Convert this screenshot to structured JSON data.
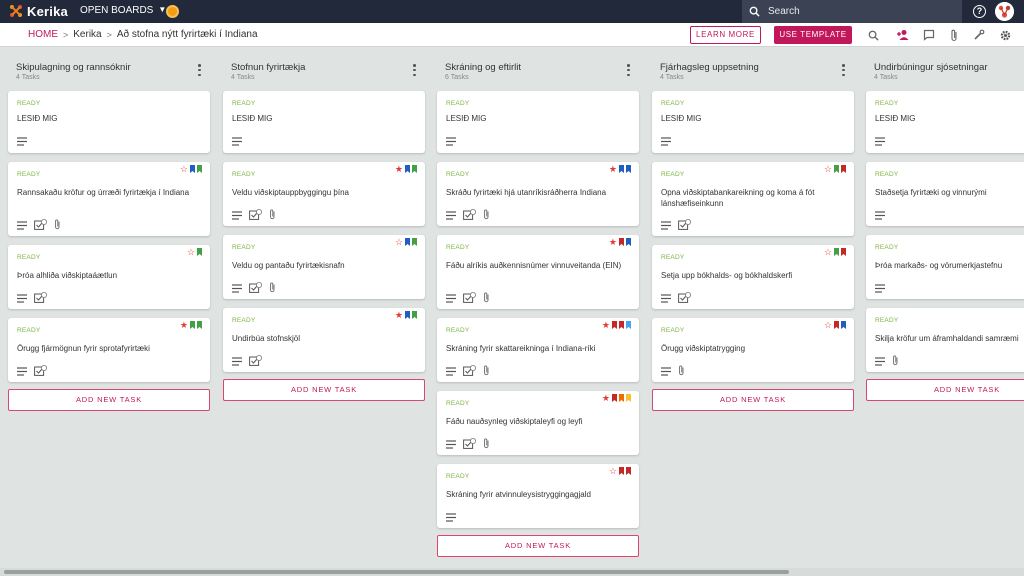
{
  "app": {
    "name": "Kerika",
    "open_boards": "OPEN BOARDS",
    "search_placeholder": "Search"
  },
  "breadcrumb": {
    "home": "HOME",
    "org": "Kerika",
    "board": "Að stofna nýtt fyrirtæki í Indiana"
  },
  "toolbar": {
    "learn_more": "LEARN MORE",
    "use_template": "USE TEMPLATE"
  },
  "colors": {
    "accent": "#c2185b",
    "ready": "#7cb342",
    "topbar": "#22293a",
    "flag_blue": "#1e5fbf",
    "flag_green": "#43a047",
    "flag_red": "#c62828",
    "flag_orange": "#ef6c00",
    "flag_yellow": "#fbc02d",
    "flag_lightblue": "#42a5f5"
  },
  "add_task_label": "ADD NEW TASK",
  "columns": [
    {
      "title": "Skipulagning og rannsóknir",
      "count": "4 Tasks",
      "cards": [
        {
          "status": "READY",
          "title": "LESIÐ MIG",
          "icons": [
            "desc"
          ],
          "star": "none",
          "flags": []
        },
        {
          "status": "READY",
          "title": "Rannsakaðu kröfur og úrræði fyrirtækja í Indiana",
          "icons": [
            "desc",
            "check",
            "clip"
          ],
          "star": "outline",
          "flags": [
            "blue",
            "green"
          ]
        },
        {
          "status": "READY",
          "title": "Þróa alhliða viðskiptaáætlun",
          "icons": [
            "desc",
            "check"
          ],
          "star": "outline",
          "flags": [
            "green"
          ]
        },
        {
          "status": "READY",
          "title": "Örugg fjármögnun fyrir sprotafyrirtæki",
          "icons": [
            "desc",
            "check"
          ],
          "star": "filled",
          "flags": [
            "green",
            "green"
          ]
        }
      ]
    },
    {
      "title": "Stofnun fyrirtækja",
      "count": "4 Tasks",
      "cards": [
        {
          "status": "READY",
          "title": "LESIÐ MIG",
          "icons": [
            "desc"
          ],
          "star": "none",
          "flags": []
        },
        {
          "status": "READY",
          "title": "Veldu viðskiptauppbyggingu þína",
          "icons": [
            "desc",
            "check",
            "clip"
          ],
          "star": "filled",
          "flags": [
            "blue",
            "green"
          ]
        },
        {
          "status": "READY",
          "title": "Veldu og pantaðu fyrirtækisnafn",
          "icons": [
            "desc",
            "check",
            "clip"
          ],
          "star": "outline",
          "flags": [
            "blue",
            "green"
          ]
        },
        {
          "status": "READY",
          "title": "Undirbúa stofnskjöl",
          "icons": [
            "desc",
            "check"
          ],
          "star": "filled",
          "flags": [
            "blue",
            "green"
          ]
        }
      ]
    },
    {
      "title": "Skráning og eftirlit",
      "count": "6 Tasks",
      "cards": [
        {
          "status": "READY",
          "title": "LESIÐ MIG",
          "icons": [
            "desc"
          ],
          "star": "none",
          "flags": []
        },
        {
          "status": "READY",
          "title": "Skráðu fyrirtæki hjá utanríkisráðherra Indiana",
          "icons": [
            "desc",
            "check",
            "clip"
          ],
          "star": "filled",
          "flags": [
            "blue",
            "blue"
          ]
        },
        {
          "status": "READY",
          "title": "Fáðu alríkis auðkennisnúmer vinnuveitanda (EIN)",
          "icons": [
            "desc",
            "check",
            "clip"
          ],
          "star": "filled",
          "flags": [
            "red",
            "blue"
          ]
        },
        {
          "status": "READY",
          "title": "Skráning fyrir skattareikninga í Indiana-ríki",
          "icons": [
            "desc",
            "check",
            "clip"
          ],
          "star": "filled",
          "flags": [
            "red",
            "red",
            "lightblue"
          ]
        },
        {
          "status": "READY",
          "title": "Fáðu nauðsynleg viðskiptaleyfi og leyfi",
          "icons": [
            "desc",
            "check",
            "clip"
          ],
          "star": "filled",
          "flags": [
            "red",
            "orange",
            "yellow"
          ]
        },
        {
          "status": "READY",
          "title": "Skráning fyrir atvinnuleysistryggingagjald",
          "icons": [
            "desc"
          ],
          "star": "outline",
          "flags": [
            "red",
            "red"
          ]
        }
      ]
    },
    {
      "title": "Fjárhagsleg uppsetning",
      "count": "4 Tasks",
      "cards": [
        {
          "status": "READY",
          "title": "LESIÐ MIG",
          "icons": [
            "desc"
          ],
          "star": "none",
          "flags": []
        },
        {
          "status": "READY",
          "title": "Opna viðskiptabankareikning og koma á fót lánshæfiseinkunn",
          "icons": [
            "desc",
            "check"
          ],
          "star": "outline",
          "flags": [
            "green",
            "red"
          ]
        },
        {
          "status": "READY",
          "title": "Setja upp bókhalds- og bókhaldskerfi",
          "icons": [
            "desc",
            "check"
          ],
          "star": "outline",
          "flags": [
            "green",
            "red"
          ]
        },
        {
          "status": "READY",
          "title": "Örugg viðskiptatrygging",
          "icons": [
            "desc",
            "clip"
          ],
          "star": "outline",
          "flags": [
            "red",
            "blue"
          ]
        }
      ]
    },
    {
      "title": "Undirbúningur sjósetningar",
      "count": "4 Tasks",
      "cards": [
        {
          "status": "READY",
          "title": "LESIÐ MIG",
          "icons": [
            "desc"
          ],
          "star": "none",
          "flags": []
        },
        {
          "status": "READY",
          "title": "Staðsetja fyrirtæki og vinnurými",
          "icons": [
            "desc"
          ],
          "star": "none",
          "flags": []
        },
        {
          "status": "READY",
          "title": "Þróa markaðs- og vörumerkjastefnu",
          "icons": [
            "desc"
          ],
          "star": "none",
          "flags": []
        },
        {
          "status": "READY",
          "title": "Skilja kröfur um áframhaldandi samræmi",
          "icons": [
            "desc",
            "clip"
          ],
          "star": "none",
          "flags": []
        }
      ]
    }
  ]
}
